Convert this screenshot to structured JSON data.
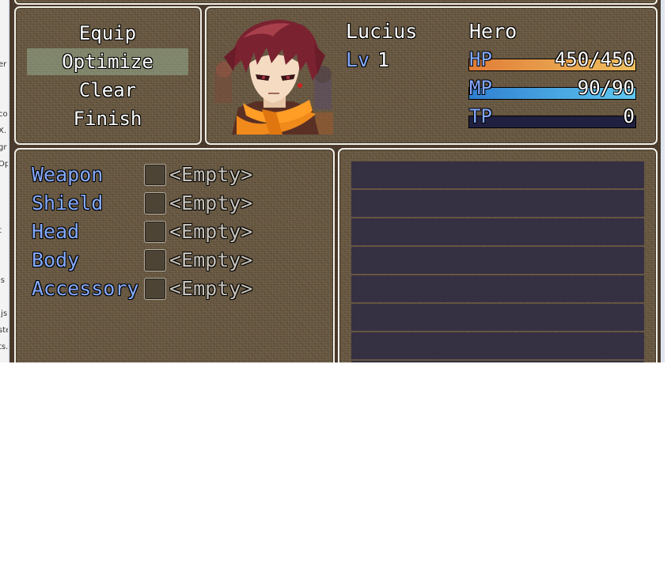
{
  "menu": {
    "items": [
      {
        "label": "Equip",
        "selected": false
      },
      {
        "label": "Optimize",
        "selected": true
      },
      {
        "label": "Clear",
        "selected": false
      },
      {
        "label": "Finish",
        "selected": false
      }
    ]
  },
  "actor": {
    "name": "Lucius",
    "class": "Hero",
    "level_label": "Lv",
    "level": "1",
    "hp": {
      "label": "HP",
      "value": "450/450",
      "fraction": 1.0,
      "color_from": "#e07d37",
      "color_to": "#f0c060"
    },
    "mp": {
      "label": "MP",
      "value": "90/90",
      "fraction": 1.0,
      "color_from": "#2f7fd0",
      "color_to": "#60c8f0"
    },
    "tp": {
      "label": "TP",
      "value": "0",
      "fraction": 0.0,
      "color_from": "#2a8a40",
      "color_to": "#8ad050"
    }
  },
  "slots": [
    {
      "label": "Weapon",
      "value": "<Empty>"
    },
    {
      "label": "Shield",
      "value": "<Empty>"
    },
    {
      "label": "Head",
      "value": "<Empty>"
    },
    {
      "label": "Body",
      "value": "<Empty>"
    },
    {
      "label": "Accessory",
      "value": "<Empty>"
    }
  ],
  "item_list_rows": 8,
  "colors": {
    "system_label": "#84aaff",
    "window_border": "#f2efe6",
    "row_bg": "#363043"
  }
}
